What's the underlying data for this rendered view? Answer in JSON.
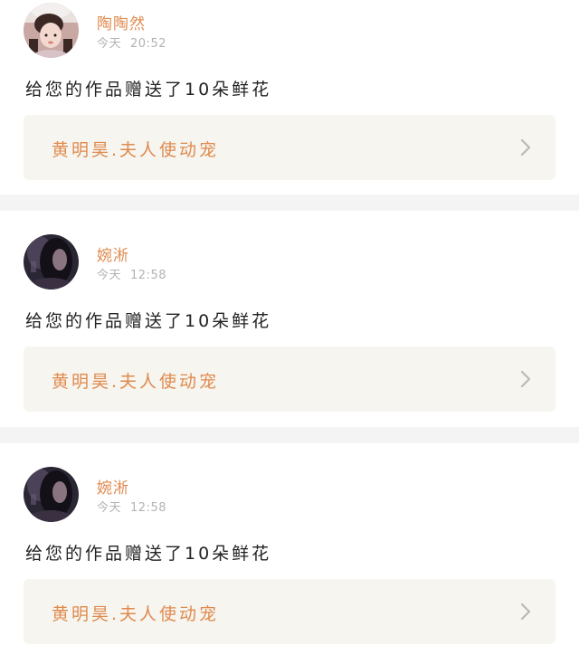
{
  "notifications": [
    {
      "user": "陶陶然",
      "day": "今天",
      "time": "20:52",
      "message": "给您的作品赠送了10朵鲜花",
      "work_title": "黄明昊.夫人使动宠",
      "avatar": "avatar-girl-hat"
    },
    {
      "user": "婉淅",
      "day": "今天",
      "time": "12:58",
      "message": "给您的作品赠送了10朵鲜花",
      "work_title": "黄明昊.夫人使动宠",
      "avatar": "avatar-dark-hair"
    },
    {
      "user": "婉淅",
      "day": "今天",
      "time": "12:58",
      "message": "给您的作品赠送了10朵鲜花",
      "work_title": "黄明昊.夫人使动宠",
      "avatar": "avatar-dark-hair"
    }
  ],
  "colors": {
    "accent": "#e08a4e",
    "link_bg": "#f6f5ef",
    "divider": "#f4f4f4",
    "muted": "#b3b3b3"
  }
}
